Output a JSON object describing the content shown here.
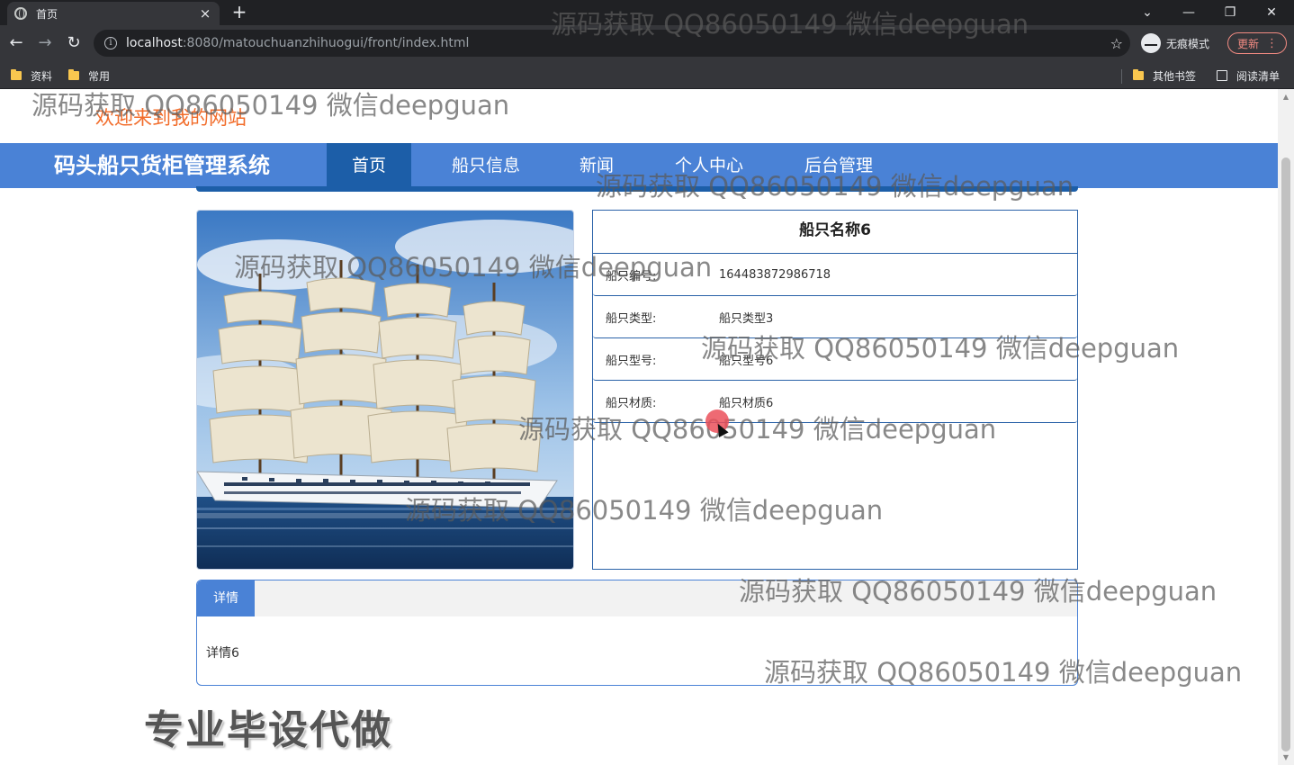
{
  "browser": {
    "tab_title": "首页",
    "tab_close": "×",
    "new_tab": "+",
    "url_host": "localhost",
    "url_path": ":8080/matouchuanzhihuogui/front/index.html",
    "incognito_label": "无痕模式",
    "update_label": "更新",
    "bookmarks": [
      "资料",
      "常用"
    ],
    "other_bookmarks": "其他书签",
    "reading_list": "阅读清单"
  },
  "site": {
    "welcome": "欢迎来到我的网站",
    "title": "码头船只货柜管理系统",
    "nav": [
      "首页",
      "船只信息",
      "新闻",
      "个人中心",
      "后台管理"
    ]
  },
  "ship": {
    "name": "船只名称6",
    "fields": [
      {
        "label": "船只编号:",
        "value": "164483872986718"
      },
      {
        "label": "船只类型:",
        "value": "船只类型3"
      },
      {
        "label": "船只型号:",
        "value": "船只型号6"
      },
      {
        "label": "船只材质:",
        "value": "船只材质6"
      }
    ]
  },
  "detail": {
    "tab": "详情",
    "content": "详情6"
  },
  "ad_text": "专业毕设代做",
  "watermark": "源码获取 QQ86050149 微信deepguan",
  "colors": {
    "nav_blue": "#4a82d6",
    "nav_active": "#1c5ea8",
    "welcome_orange": "#f26c2a"
  }
}
